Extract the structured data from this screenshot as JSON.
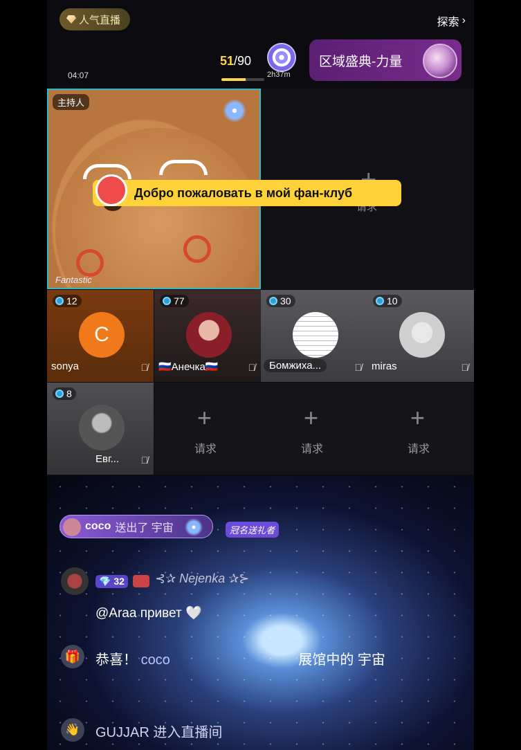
{
  "top": {
    "popular_label": "人气直播",
    "explore_label": "探索",
    "time": "04:07",
    "progress_current": "51",
    "progress_total": "/90",
    "progress_fraction": 0.57,
    "countdown": "2h37m",
    "event_label": "区域盛典-力量"
  },
  "host": {
    "label": "主持人",
    "effect_text": "Fantastic"
  },
  "banner": {
    "welcome": "Добро пожаловать в мой фан-клуб"
  },
  "request_label": "请求",
  "guests": [
    {
      "count": "12",
      "name": "sonya",
      "initial": "C"
    },
    {
      "count": "77",
      "name": "🇷🇺Анечка🇷🇺"
    },
    {
      "count": "30",
      "name": "Бомжиха..."
    },
    {
      "count": "10",
      "name": "miras"
    },
    {
      "count": "8",
      "name": "Евг..."
    }
  ],
  "chat": {
    "gift_user": "coco",
    "gift_text": "送出了 宇宙",
    "crown_badge": "冠名送礼者",
    "user_level": "32",
    "username": "⊰✰ Nejenka ✰⊱",
    "greeting": "@Araa привет 🤍",
    "congrats_prefix": "恭喜！",
    "congrats_user": "coco",
    "congrats_tail": "展馆中的 宇宙",
    "enter_text": "GUJJAR 进入直播间"
  },
  "colors": {
    "host_border": "#2fb9c9",
    "welcome_bg": "#ffd23a",
    "progress": "#ffd54a",
    "event_bg": "#6a2580"
  }
}
